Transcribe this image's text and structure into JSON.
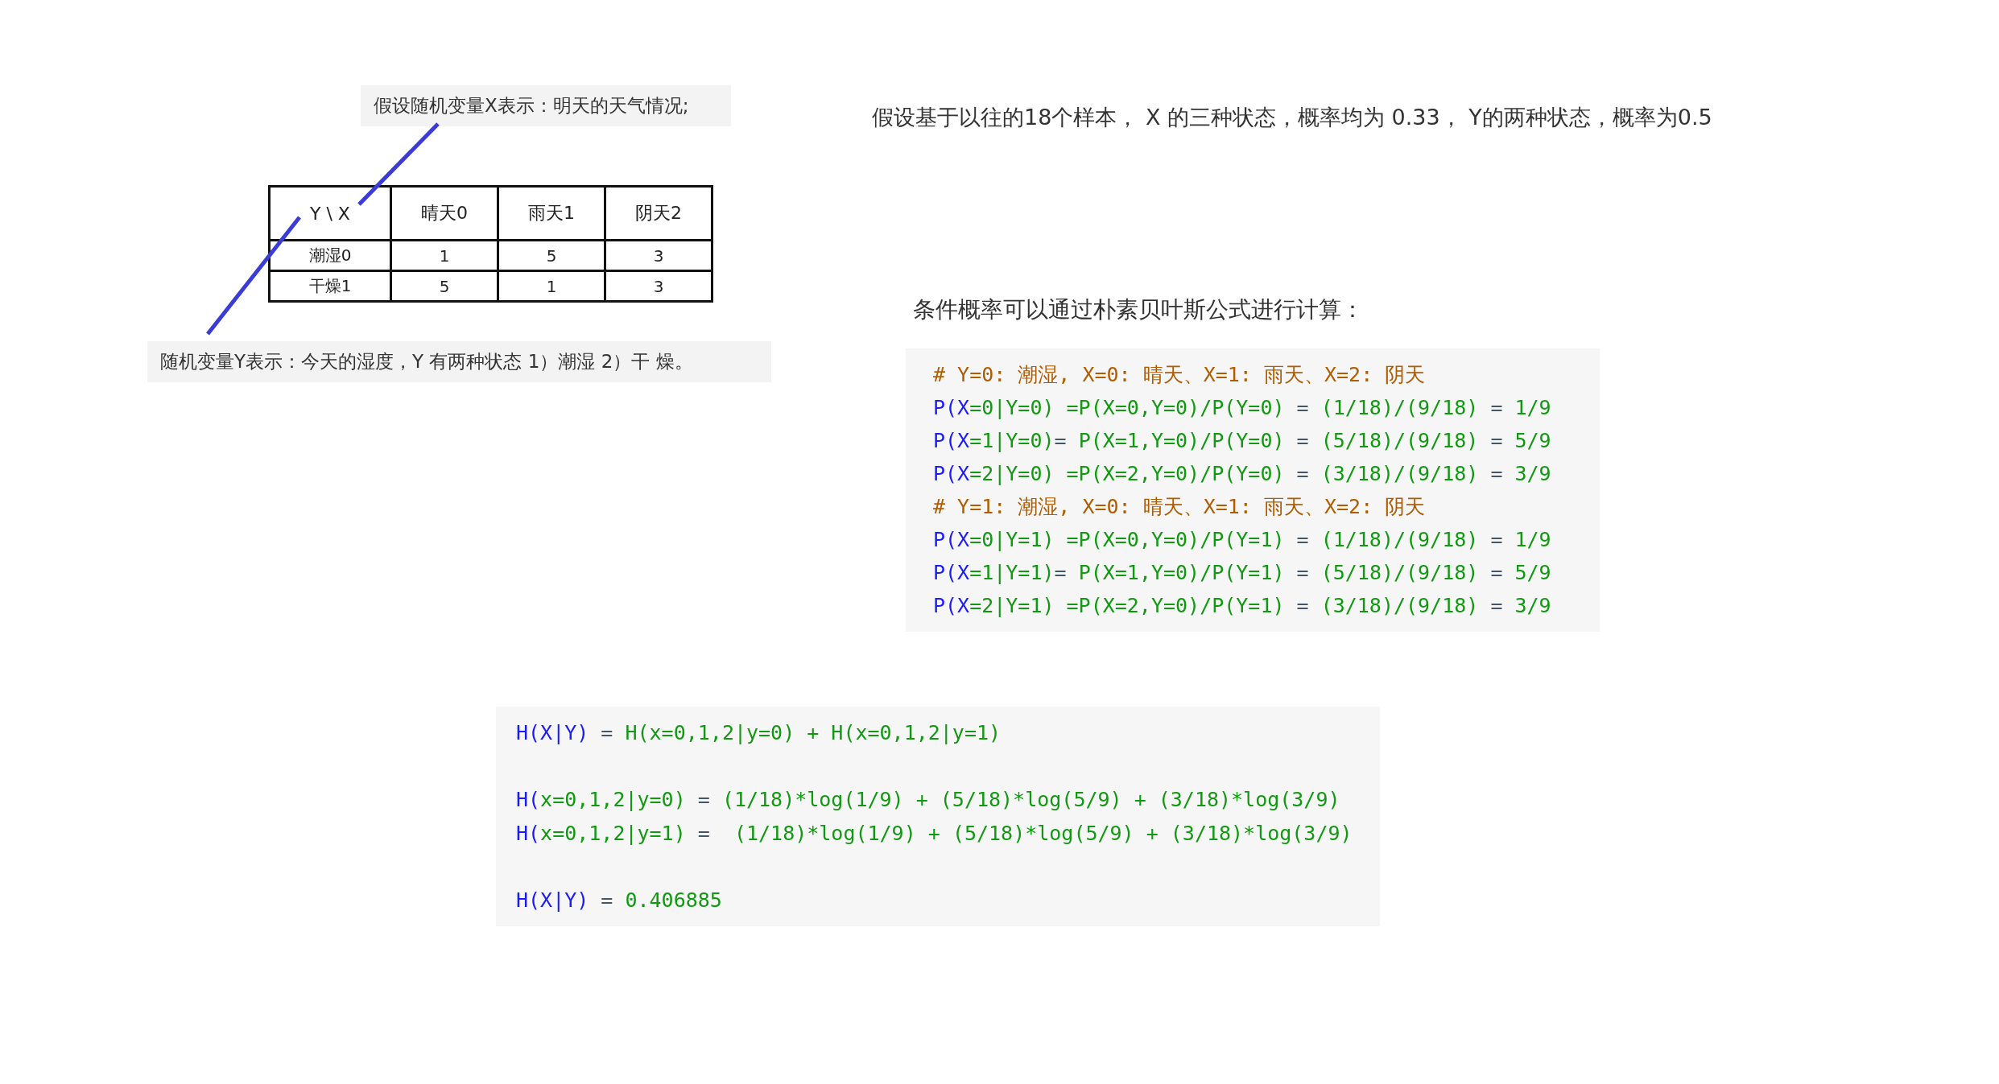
{
  "x_note": "假设随机变量X表示：明天的天气情况;",
  "table": {
    "columns": [
      "Y \\ X",
      "晴天0",
      "雨天1",
      "阴天2"
    ],
    "rows": [
      [
        "潮湿0",
        "1",
        "5",
        "3"
      ],
      [
        "干燥1",
        "5",
        "1",
        "3"
      ]
    ]
  },
  "y_note": "随机变量Y表示：今天的湿度，Y  有两种状态 1）潮湿 2）干  燥。",
  "intro": "假设基于以往的18个样本， X 的三种状态，概率均为 0.33， Y的两种状态，概率为0.5",
  "bayes_heading": "条件概率可以通过朴素贝叶斯公式进行计算：",
  "bayes_code": [
    [
      {
        "text": "# Y=0: 潮湿, X=0: 晴天、X=1: 雨天、X=2: 阴天",
        "kind": "comment"
      }
    ],
    [
      {
        "text": "P(X",
        "kind": "name"
      },
      {
        "text": "=0|Y=0) =P(X=0,Y=0)/P(Y=0) ",
        "kind": "expr"
      },
      {
        "text": "=",
        "kind": "op"
      },
      {
        "text": " (1/18)/(9/18) ",
        "kind": "expr"
      },
      {
        "text": "=",
        "kind": "op"
      },
      {
        "text": " 1/9",
        "kind": "expr"
      }
    ],
    [
      {
        "text": "P(X",
        "kind": "name"
      },
      {
        "text": "=1|Y=0)",
        "kind": "expr"
      },
      {
        "text": "=",
        "kind": "op"
      },
      {
        "text": " P(X=1,Y=0)/P(Y=0) ",
        "kind": "expr"
      },
      {
        "text": "=",
        "kind": "op"
      },
      {
        "text": " (5/18)/(9/18) ",
        "kind": "expr"
      },
      {
        "text": "=",
        "kind": "op"
      },
      {
        "text": " 5/9",
        "kind": "expr"
      }
    ],
    [
      {
        "text": "P(X",
        "kind": "name"
      },
      {
        "text": "=2|Y=0) =P(X=2,Y=0)/P(Y=0) ",
        "kind": "expr"
      },
      {
        "text": "=",
        "kind": "op"
      },
      {
        "text": " (3/18)/(9/18) ",
        "kind": "expr"
      },
      {
        "text": "=",
        "kind": "op"
      },
      {
        "text": " 3/9",
        "kind": "expr"
      }
    ],
    [
      {
        "text": "# Y=1: 潮湿, X=0: 晴天、X=1: 雨天、X=2: 阴天",
        "kind": "comment"
      }
    ],
    [
      {
        "text": "P(X",
        "kind": "name"
      },
      {
        "text": "=0|Y=1) =P(X=0,Y=0)/P(Y=1) ",
        "kind": "expr"
      },
      {
        "text": "=",
        "kind": "op"
      },
      {
        "text": " (1/18)/(9/18) ",
        "kind": "expr"
      },
      {
        "text": "=",
        "kind": "op"
      },
      {
        "text": " 1/9",
        "kind": "expr"
      }
    ],
    [
      {
        "text": "P(X",
        "kind": "name"
      },
      {
        "text": "=1|Y=1)",
        "kind": "expr"
      },
      {
        "text": "=",
        "kind": "op"
      },
      {
        "text": " P(X=1,Y=0)/P(Y=1) ",
        "kind": "expr"
      },
      {
        "text": "=",
        "kind": "op"
      },
      {
        "text": " (5/18)/(9/18) ",
        "kind": "expr"
      },
      {
        "text": "=",
        "kind": "op"
      },
      {
        "text": " 5/9",
        "kind": "expr"
      }
    ],
    [
      {
        "text": "P(X",
        "kind": "name"
      },
      {
        "text": "=2|Y=1) =P(X=2,Y=0)/P(Y=1) ",
        "kind": "expr"
      },
      {
        "text": "=",
        "kind": "op"
      },
      {
        "text": " (3/18)/(9/18) ",
        "kind": "expr"
      },
      {
        "text": "=",
        "kind": "op"
      },
      {
        "text": " 3/9",
        "kind": "expr"
      }
    ]
  ],
  "entropy_code": [
    [
      [
        {
          "text": "H(X|Y)",
          "kind": "name"
        },
        {
          "text": " = ",
          "kind": "op"
        },
        {
          "text": "H(x=0,1,2|y=0) + H(x=0,1,2|y=1)",
          "kind": "expr"
        }
      ]
    ],
    [
      [
        {
          "text": "H(",
          "kind": "name"
        },
        {
          "text": "x=0,1,2|y=0)",
          "kind": "expr"
        },
        {
          "text": " = ",
          "kind": "op"
        },
        {
          "text": "(1/18)*log(1/9) + (5/18)*log(5/9) + (3/18)*log(3/9)",
          "kind": "expr"
        }
      ],
      [
        {
          "text": "H(",
          "kind": "name"
        },
        {
          "text": "x=0,1,2|y=1)",
          "kind": "expr"
        },
        {
          "text": " =  ",
          "kind": "op"
        },
        {
          "text": "(1/18)*log(1/9) + (5/18)*log(5/9) + (3/18)*log(3/9)",
          "kind": "expr"
        }
      ]
    ],
    [
      [
        {
          "text": "H(X|Y)",
          "kind": "name"
        },
        {
          "text": " = ",
          "kind": "op"
        },
        {
          "text": "0.406885",
          "kind": "expr"
        }
      ]
    ]
  ]
}
